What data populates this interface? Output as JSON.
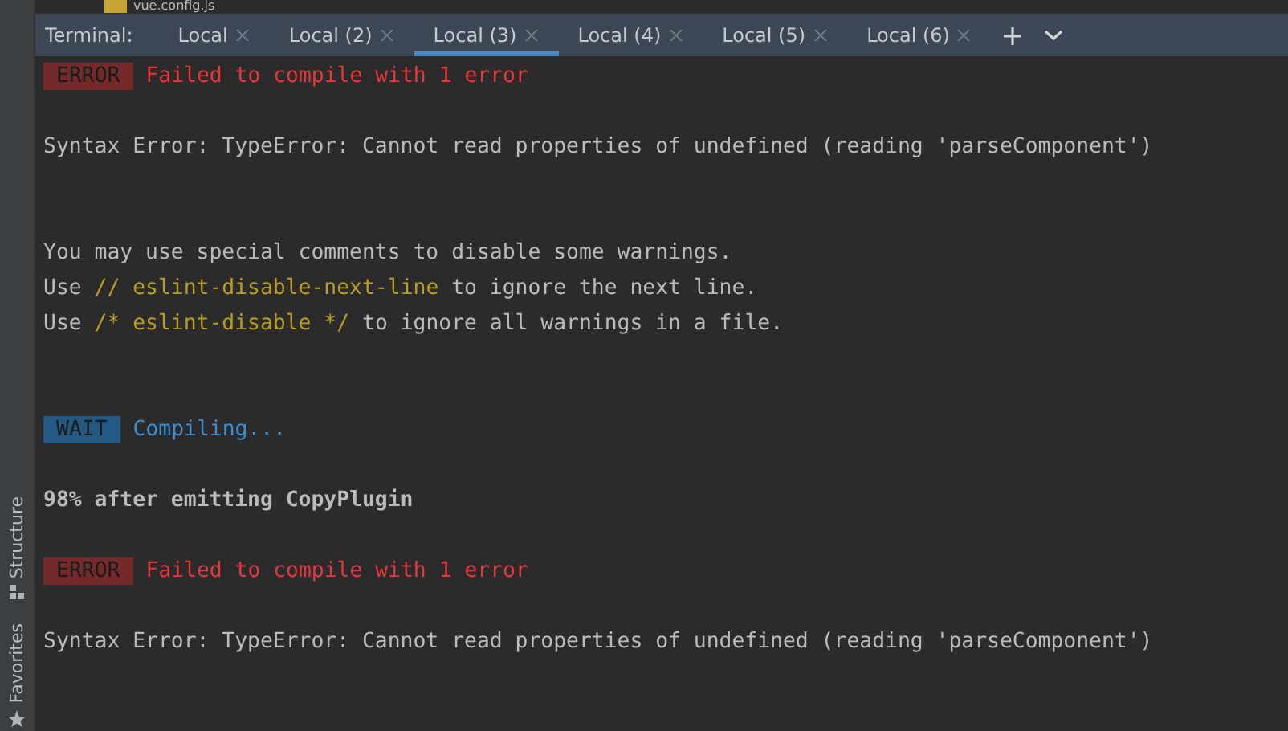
{
  "file_tree_row": {
    "name": "vue.config.js"
  },
  "terminal": {
    "label": "Terminal:",
    "tabs": [
      {
        "label": "Local",
        "selected": false
      },
      {
        "label": "Local (2)",
        "selected": false
      },
      {
        "label": "Local (3)",
        "selected": true
      },
      {
        "label": "Local (4)",
        "selected": false
      },
      {
        "label": "Local (5)",
        "selected": false
      },
      {
        "label": "Local (6)",
        "selected": false
      }
    ],
    "lines": [
      {
        "kind": "error",
        "badge": "ERROR",
        "text": "Failed to compile with 1 error"
      },
      {
        "kind": "blank"
      },
      {
        "kind": "plain",
        "text": "Syntax Error: TypeError: Cannot read properties of undefined (reading 'parseComponent')"
      },
      {
        "kind": "blank"
      },
      {
        "kind": "blank"
      },
      {
        "kind": "plain",
        "text": "You may use special comments to disable some warnings."
      },
      {
        "kind": "parts",
        "parts": [
          {
            "text": "Use ",
            "code": false
          },
          {
            "text": "// eslint-disable-next-line",
            "code": true
          },
          {
            "text": " to ignore the next line.",
            "code": false
          }
        ]
      },
      {
        "kind": "parts",
        "parts": [
          {
            "text": "Use ",
            "code": false
          },
          {
            "text": "/* eslint-disable */",
            "code": true
          },
          {
            "text": " to ignore all warnings in a file.",
            "code": false
          }
        ]
      },
      {
        "kind": "blank"
      },
      {
        "kind": "blank"
      },
      {
        "kind": "wait",
        "badge": "WAIT",
        "text": "Compiling..."
      },
      {
        "kind": "blank"
      },
      {
        "kind": "bold",
        "text": "98% after emitting CopyPlugin"
      },
      {
        "kind": "blank"
      },
      {
        "kind": "error",
        "badge": "ERROR",
        "text": "Failed to compile with 1 error"
      },
      {
        "kind": "blank"
      },
      {
        "kind": "plain",
        "text": "Syntax Error: TypeError: Cannot read properties of undefined (reading 'parseComponent')"
      }
    ]
  },
  "side_panels": [
    {
      "label": "Structure"
    },
    {
      "label": "Favorites"
    }
  ]
}
